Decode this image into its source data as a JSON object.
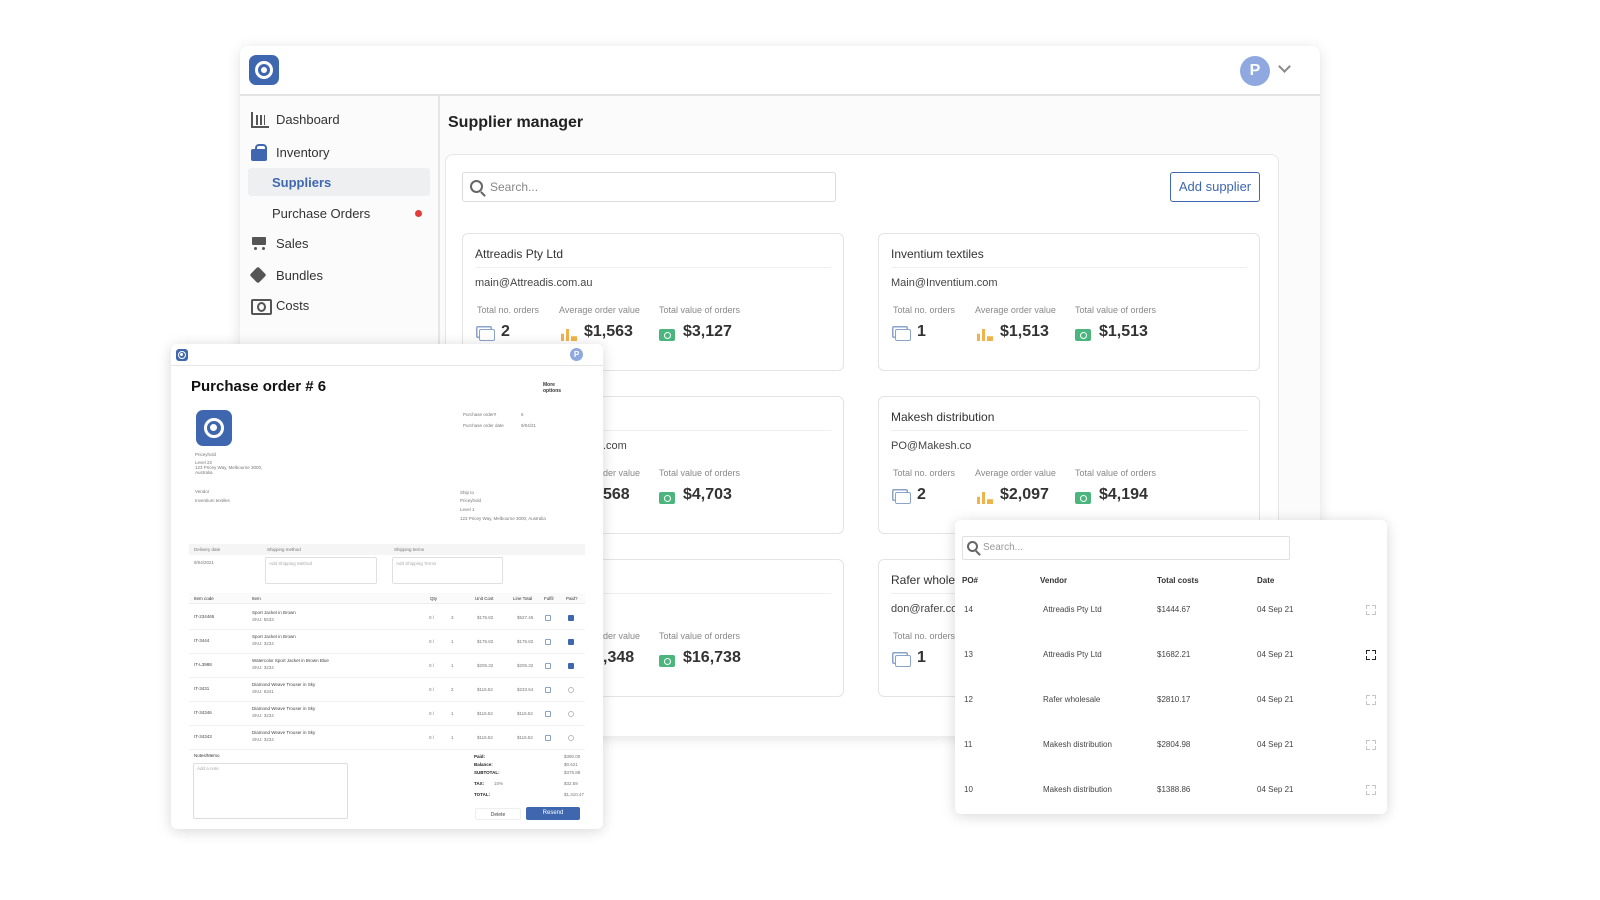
{
  "main": {
    "avatar_initial": "P",
    "page_title": "Supplier manager",
    "search_placeholder": "Search...",
    "add_supplier_label": "Add supplier",
    "sidebar": [
      {
        "label": "Dashboard",
        "icon": "chart-icon"
      },
      {
        "label": "Inventory",
        "icon": "bag-icon"
      },
      {
        "label": "Suppliers",
        "icon": "",
        "active": true
      },
      {
        "label": "Purchase Orders",
        "icon": "",
        "badge": "red-dot"
      },
      {
        "label": "Sales",
        "icon": "cart-icon"
      },
      {
        "label": "Bundles",
        "icon": "tag-icon"
      },
      {
        "label": "Costs",
        "icon": "money-icon"
      }
    ],
    "stat_labels": {
      "orders": "Total no. orders",
      "avg": "Average order value",
      "total": "Total value of orders"
    },
    "cards": [
      {
        "name": "Attreadis Pty Ltd",
        "email": "main@Attreadis.com.au",
        "orders": "2",
        "avg": "$1,563",
        "total": "$3,127"
      },
      {
        "name": "Inventium textiles",
        "email": "Main@Inventium.com",
        "orders": "1",
        "avg": "$1,513",
        "total": "$1,513"
      },
      {
        "name": "",
        "email": ".com",
        "orders": "",
        "avg": "568",
        "total": "$4,703"
      },
      {
        "name": "Makesh distribution",
        "email": "PO@Makesh.co",
        "orders": "2",
        "avg": "$2,097",
        "total": "$4,194"
      },
      {
        "name": "",
        "email": "",
        "orders": "",
        "avg": ",348",
        "total": "$16,738"
      },
      {
        "name": "Rafer wholes",
        "email": "don@rafer.co",
        "orders": "1",
        "avg": "",
        "total": ""
      }
    ],
    "card_partial_labels": {
      "avg": "der value",
      "orders_cut": "Total no. orders"
    }
  },
  "purchase_order": {
    "avatar_initial": "P",
    "title": "Purchase order # 6",
    "more_options": "More options",
    "meta": {
      "po_label": "Purchase order#",
      "po_value": "6",
      "date_label": "Purchase order date",
      "date_value": "9/04/21"
    },
    "company": {
      "name": "Priceyhold",
      "addr1": "Level 22",
      "addr2": "123 Pricey Way, Melbourne 3000,",
      "addr3": "Australia"
    },
    "vendor": {
      "label": "Vendor",
      "value": "Inventium textiles"
    },
    "ship_to": {
      "label": "Ship to",
      "l1": "Priceyhold",
      "l2": "Level 1",
      "l3": "123 Pricey Way, Melbourne 3000, Australia"
    },
    "delivery": {
      "date_label": "Delivery date",
      "date_value": "9/04/2021",
      "method_label": "Shipping method",
      "method_ph": "Add Shipping Method",
      "terms_label": "Shipping terms",
      "terms_ph": "Add Shipping Terms"
    },
    "columns": [
      "Item code",
      "Item",
      "Qty",
      "Unit Cost",
      "Line Total",
      "Fulfil",
      "Paid?"
    ],
    "items": [
      {
        "code": "IT-234465",
        "item": "Sport Jacket in Brown",
        "sku": "SKU: 5533",
        "recv": "0 /",
        "qty": "3",
        "unit": "$175.82",
        "line": "$527.46",
        "paid": true
      },
      {
        "code": "IT-3444",
        "item": "Sport Jacket in Brown",
        "sku": "SKU: 3234",
        "recv": "0 /",
        "qty": "1",
        "unit": "$175.82",
        "line": "$175.82",
        "paid": true
      },
      {
        "code": "IT-L3988",
        "item": "Watercolor Sport Jacket in Brown Blue",
        "sku": "SKU: 3234",
        "recv": "0 /",
        "qty": "1",
        "unit": "$205.32",
        "line": "$205.32",
        "paid": true
      },
      {
        "code": "IT-3431",
        "item": "Diamond Weave Trouser in Sky",
        "sku": "SKU: 6341",
        "recv": "0 /",
        "qty": "2",
        "unit": "$116.82",
        "line": "$233.64",
        "paid": false
      },
      {
        "code": "IT-34346",
        "item": "Diamond Weave Trouser in Sky",
        "sku": "SKU: 3234",
        "recv": "0 /",
        "qty": "1",
        "unit": "$116.82",
        "line": "$116.82",
        "paid": false
      },
      {
        "code": "IT-34343",
        "item": "Diamond Weave Trouser in Sky",
        "sku": "SKU: 3234",
        "recv": "0 /",
        "qty": "1",
        "unit": "$116.82",
        "line": "$116.82",
        "paid": false
      }
    ],
    "notes_label": "Notes/Memo",
    "notes_ph": "Add a note",
    "totals": [
      {
        "label": "Paid:",
        "value": "$390.00"
      },
      {
        "label": "Balance:",
        "value": "$0.621"
      },
      {
        "label": "SUBTOTAL:",
        "value": "$375.88"
      },
      {
        "label": "TAX:",
        "pct": "10%",
        "value": "$32.59"
      },
      {
        "label": "TOTAL:",
        "value": "$1,310.47"
      }
    ],
    "delete_label": "Delete",
    "resend_label": "Resend"
  },
  "po_list": {
    "search_placeholder": "Search...",
    "columns": [
      "PO#",
      "Vendor",
      "Total costs",
      "Date"
    ],
    "rows": [
      {
        "po": "14",
        "vendor": "Attreadis Pty Ltd",
        "total": "$1444.67",
        "date": "04 Sep 21",
        "hover": false
      },
      {
        "po": "13",
        "vendor": "Attreadis Pty Ltd",
        "total": "$1682.21",
        "date": "04 Sep 21",
        "hover": true
      },
      {
        "po": "12",
        "vendor": "Rafer wholesale",
        "total": "$2810.17",
        "date": "04 Sep 21",
        "hover": false
      },
      {
        "po": "11",
        "vendor": "Makesh distribution",
        "total": "$2804.98",
        "date": "04 Sep 21",
        "hover": false
      },
      {
        "po": "10",
        "vendor": "Makesh distribution",
        "total": "$1388.86",
        "date": "04 Sep 21",
        "hover": false
      }
    ]
  }
}
